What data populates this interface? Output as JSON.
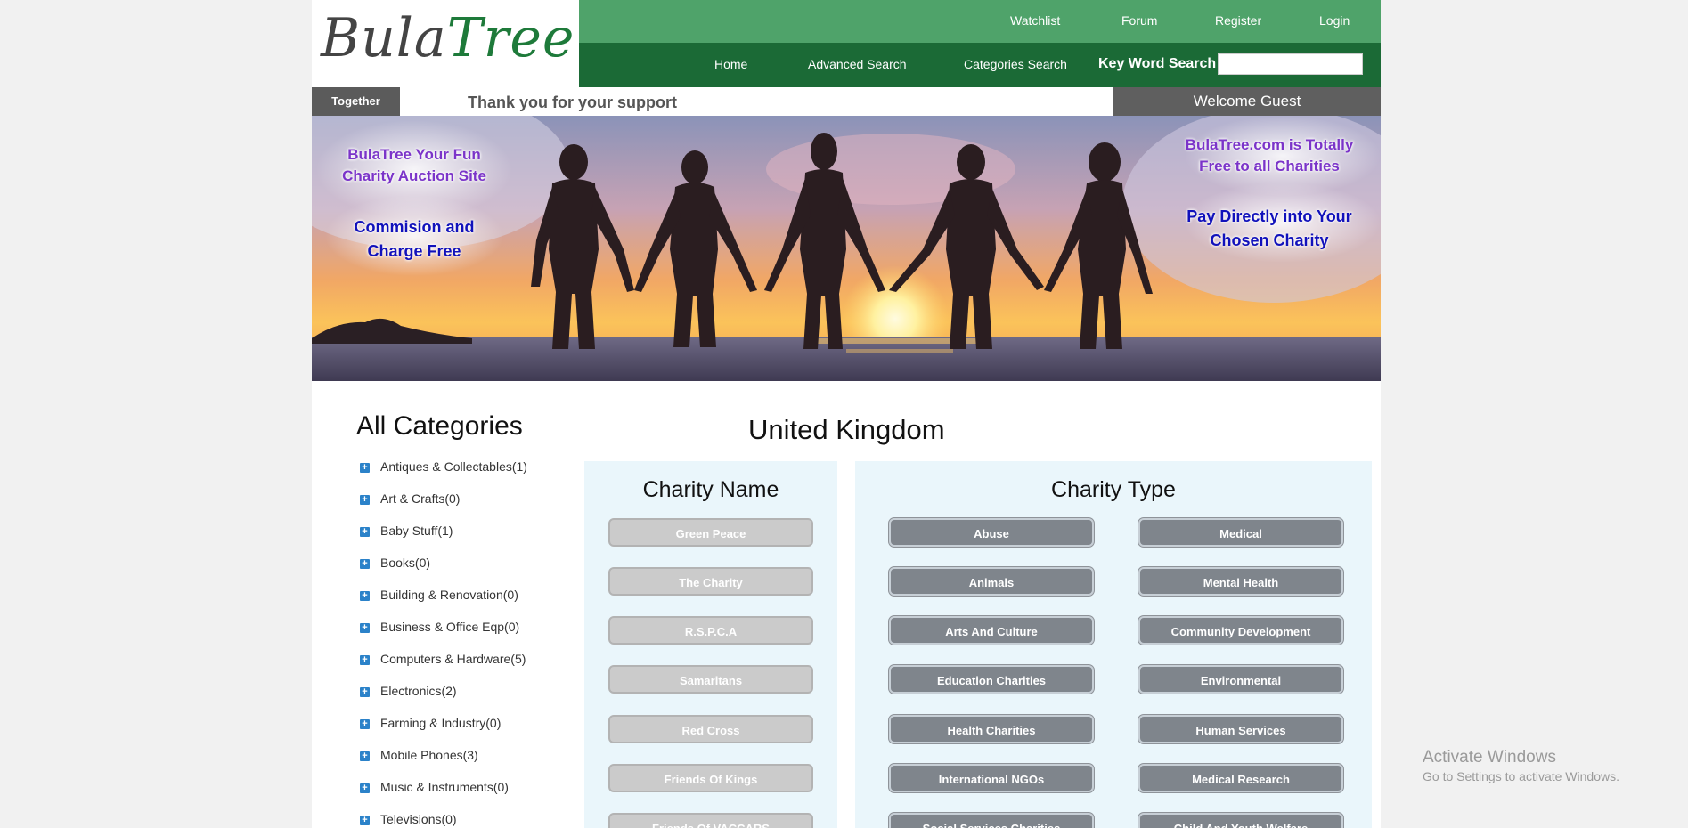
{
  "header": {
    "logo": {
      "part1": "Bula",
      "part2": "Tree"
    },
    "top_links": [
      "Watchlist",
      "Forum",
      "Register",
      "Login"
    ],
    "main_links": [
      "Home",
      "Advanced Search",
      "Categories Search"
    ],
    "keyword_search_label": "Key Word Search",
    "keyword_search_value": ""
  },
  "strip": {
    "together": "Together",
    "thanks": "Thank you for your support",
    "welcome": "Welcome Guest"
  },
  "hero": {
    "left_line1": "BulaTree Your Fun",
    "left_line2": "Charity Auction Site",
    "left_line3": "Commision and",
    "left_line4": "Charge Free",
    "right_line1": "BulaTree.com is Totally",
    "right_line2": "Free to all Charities",
    "right_line3": "Pay Directly into Your",
    "right_line4": "Chosen Charity"
  },
  "categories": {
    "heading": "All Categories",
    "items": [
      "Antiques & Collectables(1)",
      "Art & Crafts(0)",
      "Baby Stuff(1)",
      "Books(0)",
      "Building & Renovation(0)",
      "Business & Office Eqp(0)",
      "Computers & Hardware(5)",
      "Electronics(2)",
      "Farming & Industry(0)",
      "Mobile Phones(3)",
      "Music & Instruments(0)",
      "Televisions(0)"
    ]
  },
  "country": "United Kingdom",
  "charity_name": {
    "title": "Charity Name",
    "items": [
      "Green Peace",
      "The Charity",
      "R.S.P.C.A",
      "Samaritans",
      "Red Cross",
      "Friends Of Kings",
      "Friends Of VACCARS"
    ]
  },
  "charity_type": {
    "title": "Charity Type",
    "left": [
      "Abuse",
      "Animals",
      "Arts And Culture",
      "Education Charities",
      "Health Charities",
      "International NGOs",
      "Social Services Charities"
    ],
    "right": [
      "Medical",
      "Mental Health",
      "Community Development",
      "Environmental",
      "Human Services",
      "Medical Research",
      "Child And Youth Welfare"
    ]
  },
  "windows_watermark": {
    "title": "Activate Windows",
    "subtitle": "Go to Settings to activate Windows."
  },
  "colors": {
    "top_nav": "#4fa36a",
    "main_nav": "#1b6a36",
    "hero_purple": "#7b34c9",
    "hero_blue": "#1111bb",
    "light_button": "#cbcbcb",
    "dark_button": "#7f858c",
    "panel_bg": "#eaf6fb"
  }
}
